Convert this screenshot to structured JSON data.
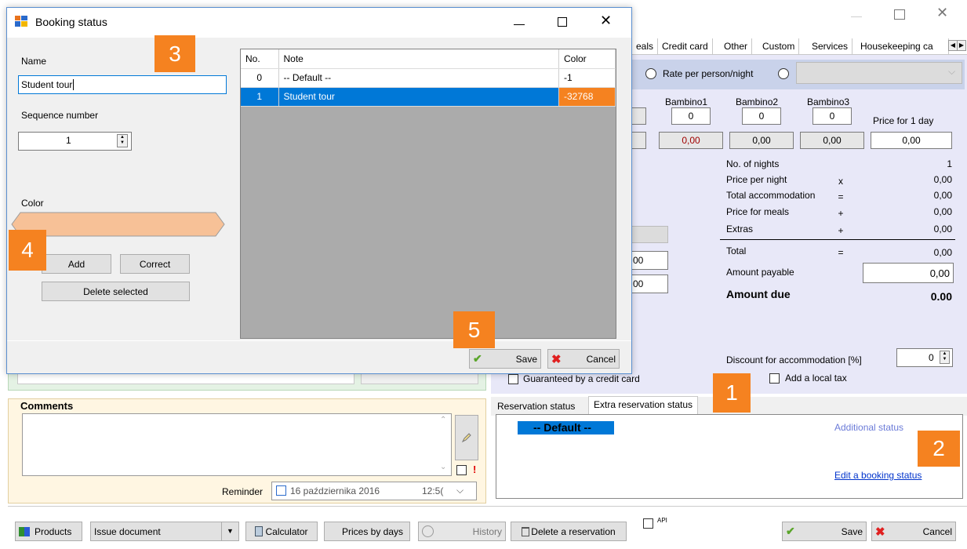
{
  "main": {
    "tabs": [
      "eals",
      "Credit card",
      "Other",
      "Custom",
      "Services",
      "Housekeeping ca"
    ],
    "rate_option": "Rate per person/night",
    "bambino_headers": [
      "Bambino1",
      "Bambino2",
      "Bambino3"
    ],
    "bambino_values": [
      "0",
      "0",
      "0"
    ],
    "price_for_1_day_label": "Price for 1 day",
    "price_for_1_day": "0,00",
    "price_row": [
      "0,00",
      "0,00",
      "0,00"
    ],
    "partial_00_a": "00",
    "partial_00_b": "00",
    "summary": {
      "nights_label": "No. of nights",
      "nights_val": "1",
      "ppn_label": "Price per night",
      "ppn_op": "x",
      "ppn_val": "0,00",
      "total_acc_label": "Total accommodation",
      "total_acc_op": "=",
      "total_acc_val": "0,00",
      "meals_label": "Price for meals",
      "meals_op": "+",
      "meals_val": "0,00",
      "extras_label": "Extras",
      "extras_op": "+",
      "extras_val": "0,00",
      "total_label": "Total",
      "total_op": "=",
      "total_val": "0,00",
      "payable_label": "Amount payable",
      "payable_val": "0,00",
      "due_label": "Amount due",
      "due_val": "0.00"
    },
    "discount_label": "Discount for accommodation [%]",
    "discount_val": "0",
    "guaranteed_label": "Guaranteed by a credit card",
    "local_tax_label": "Add a local tax",
    "status_tabs": [
      "Reservation status",
      "Extra reservation status"
    ],
    "status_selected": "-- Default --",
    "additional_status": "Additional status",
    "edit_booking_status": "Edit a booking status",
    "comments_label": "Comments",
    "reminder_label": "Reminder",
    "reminder_date": "16 października 2016",
    "reminder_time": "12:5(",
    "bottom": {
      "products": "Products",
      "issue_document": "Issue document",
      "calculator": "Calculator",
      "prices_by_days": "Prices by days",
      "history": "History",
      "delete_reservation": "Delete a reservation",
      "api": "API",
      "save": "Save",
      "cancel": "Cancel"
    }
  },
  "dialog": {
    "title": "Booking status",
    "name_label": "Name",
    "name_value": "Student tour",
    "seq_label": "Sequence number",
    "seq_value": "1",
    "color_label": "Color",
    "color_hex": "#f7c197",
    "add": "Add",
    "correct": "Correct",
    "delete_selected": "Delete selected",
    "save": "Save",
    "cancel": "Cancel",
    "grid_headers": [
      "No.",
      "Note",
      "Color"
    ],
    "grid_rows": [
      {
        "no": "0",
        "note": "-- Default --",
        "color": "-1"
      },
      {
        "no": "1",
        "note": "Student tour",
        "color": "-32768"
      }
    ]
  },
  "callouts": [
    "1",
    "2",
    "3",
    "4",
    "5"
  ],
  "colors": {
    "accent": "#f58220",
    "selection": "#0078d7",
    "panel": "#e8e8f8"
  }
}
